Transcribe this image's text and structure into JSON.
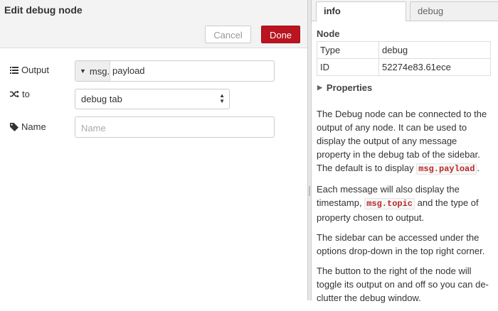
{
  "editor": {
    "title": "Edit debug node",
    "cancel_label": "Cancel",
    "done_label": "Done",
    "output": {
      "label": "Output",
      "type_prefix": "msg.",
      "value": "payload"
    },
    "to": {
      "label": "to",
      "selected": "debug tab"
    },
    "name": {
      "label": "Name",
      "placeholder": "Name",
      "value": ""
    }
  },
  "sidebar": {
    "tabs": {
      "info": "info",
      "debug": "debug"
    },
    "node_heading": "Node",
    "table": [
      {
        "key": "Type",
        "value": "debug"
      },
      {
        "key": "ID",
        "value": "52274e83.61ece"
      }
    ],
    "properties_label": "Properties",
    "description": {
      "p1_a": "The Debug node can be connected to the output of any node. It can be used to display the output of any message property in the debug tab of the sidebar. The default is to display ",
      "p1_code": "msg.payload",
      "p1_b": ".",
      "p2_a": "Each message will also display the timestamp, ",
      "p2_code": "msg.topic",
      "p2_b": " and the type of property chosen to output.",
      "p3": "The sidebar can be accessed under the options drop-down in the top right corner.",
      "p4": "The button to the right of the node will toggle its output on and off so you can de-clutter the debug window."
    }
  },
  "colors": {
    "done_button": "#b9141f",
    "code_text": "#b72828"
  }
}
